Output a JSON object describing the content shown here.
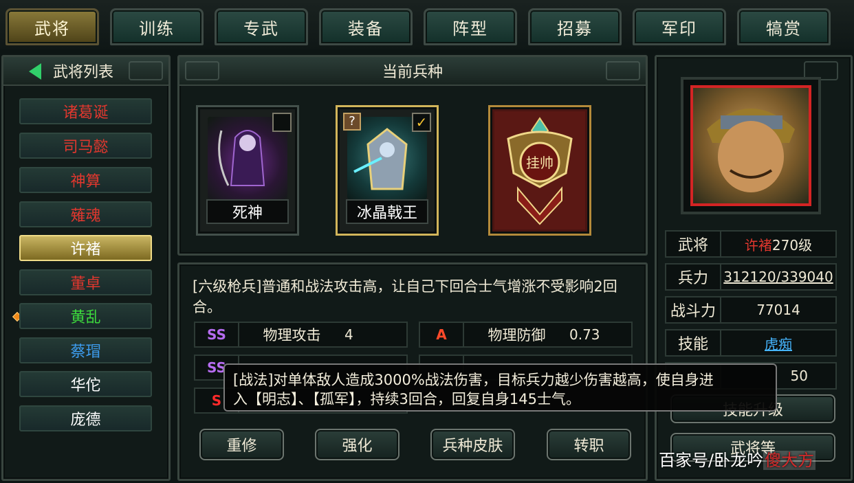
{
  "tabs": [
    "武将",
    "训练",
    "专武",
    "装备",
    "阵型",
    "招募",
    "军印",
    "犒赏"
  ],
  "active_tab": 0,
  "left_panel": {
    "title": "武将列表",
    "generals": [
      {
        "name": "诸葛诞",
        "color": "#e0372e"
      },
      {
        "name": "司马懿",
        "color": "#e0372e"
      },
      {
        "name": "神算",
        "color": "#e0372e"
      },
      {
        "name": "薙魂",
        "color": "#e0372e"
      },
      {
        "name": "许褚",
        "color": "#ffffff"
      },
      {
        "name": "董卓",
        "color": "#e0372e"
      },
      {
        "name": "黄乱",
        "color": "#3ddb3d"
      },
      {
        "name": "蔡瑁",
        "color": "#3d9df0"
      },
      {
        "name": "华佗",
        "color": "#ffffff"
      },
      {
        "name": "庞德",
        "color": "#ffffff"
      }
    ]
  },
  "center": {
    "title": "当前兵种",
    "units": [
      {
        "label": "死神"
      },
      {
        "label": "冰晶戟王"
      },
      {
        "label": "挂帅"
      }
    ],
    "description": "[六级枪兵]普通和战法攻击高，让自己下回合士气增涨不受影响2回合。",
    "stats": [
      {
        "grade": "SS",
        "grade_color": "#b66cf0",
        "name": "物理攻击",
        "value": "4"
      },
      {
        "grade": "A",
        "grade_color": "#ff4a2a",
        "name": "物理防御",
        "value": "0.73"
      },
      {
        "grade": "SS",
        "grade_color": "#b66cf0",
        "name": "",
        "value": ""
      },
      {
        "grade": "",
        "grade_color": "#ff4a2a",
        "name": "",
        "value": ""
      },
      {
        "grade": "S",
        "grade_color": "#ff2a2a",
        "name": "",
        "value": ""
      }
    ],
    "buttons": [
      "重修",
      "强化",
      "兵种皮肤",
      "转职"
    ]
  },
  "right_panel": {
    "rows": [
      {
        "key": "武将",
        "value": "许褚270级",
        "name_part": "许褚",
        "level_part": "270级"
      },
      {
        "key": "兵力",
        "value": "312120/339040"
      },
      {
        "key": "战斗力",
        "value": "77014"
      },
      {
        "key": "技能",
        "value": "虎痴"
      },
      {
        "key": "",
        "value": "50"
      }
    ],
    "buttons": [
      "技能升级",
      "武将等"
    ]
  },
  "tooltip": {
    "line1": "[战法]对单体敌人造成3000%战法伤害，目标兵力越少伤害越高，使自身进",
    "line2": "入【明志】、【孤军】，持续3回合，回复自身145士气。"
  },
  "watermark": {
    "prefix": "百家号/卧龙吟",
    "highlight": "傻大方"
  },
  "colors": {
    "accent_gold": "#d2b55a",
    "panel_border": "#39453f",
    "skill_link": "#46b6ff",
    "name_red": "#e0372e"
  }
}
